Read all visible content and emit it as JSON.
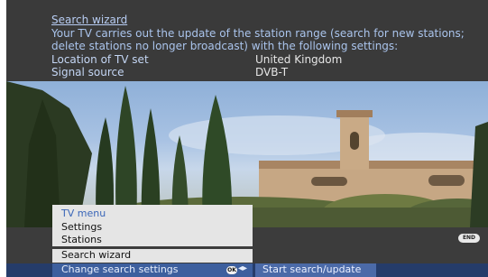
{
  "info": {
    "title": "Search wizard",
    "description": "Your TV carries out the update of the station range (search for new stations; delete stations no longer broadcast) with the following settings:",
    "rows": [
      {
        "label": "Location of TV set",
        "value": "United Kingdom"
      },
      {
        "label": "Signal source",
        "value": "DVB-T"
      }
    ]
  },
  "badges": {
    "end": "END",
    "ok": "OK"
  },
  "menu": {
    "header": "TV menu",
    "items": [
      "Settings",
      "Stations"
    ],
    "sub_item": "Search wizard",
    "selected": "Change search settings",
    "nav_glyph": "◂▸"
  },
  "action": {
    "label": "Start search/update"
  }
}
